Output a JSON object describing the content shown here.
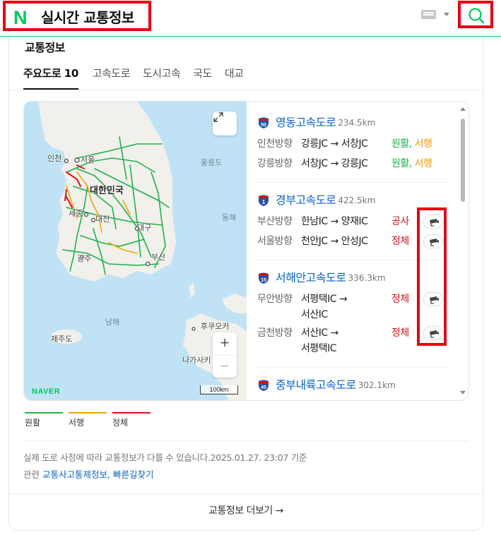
{
  "header": {
    "logo": "N",
    "title": "실시간 교통정보",
    "keyboard_icon": "keyboard-icon",
    "search_icon": "search-icon"
  },
  "section": {
    "title": "교통정보",
    "tabs": [
      {
        "label": "주요도로 10",
        "active": true
      },
      {
        "label": "고속도로",
        "active": false
      },
      {
        "label": "도시고속",
        "active": false
      },
      {
        "label": "국도",
        "active": false
      },
      {
        "label": "대교",
        "active": false
      }
    ]
  },
  "map": {
    "labels": {
      "incheon": "인천",
      "seoul": "서울",
      "country": "대한민국",
      "sejong": "세종",
      "daejeon": "대전",
      "daegu": "대구",
      "gwangju": "광주",
      "busan": "부산",
      "ulleung": "울릉도",
      "east_sea": "동해",
      "south_sea": "남해",
      "jeju": "제주도",
      "fukuoka": "후쿠오카",
      "nagasaki": "나가사키"
    },
    "brand": "NAVER",
    "scale": "100km",
    "zoom_in": "+",
    "zoom_out": "−"
  },
  "roads": [
    {
      "number": "50",
      "shield_color": "#2352a8",
      "name": "영동고속도로",
      "length": "234.5km",
      "directions": [
        {
          "dir": "인천방향",
          "route": "강릉JC → 서창JC",
          "status_parts": [
            {
              "text": "원활",
              "c": "g"
            },
            {
              "text": ", ",
              "c": "g"
            },
            {
              "text": "서행",
              "c": "o"
            }
          ],
          "cctv": false
        },
        {
          "dir": "강릉방향",
          "route": "서창JC → 강릉JC",
          "status_parts": [
            {
              "text": "원활",
              "c": "g"
            },
            {
              "text": ", ",
              "c": "g"
            },
            {
              "text": "서행",
              "c": "o"
            }
          ],
          "cctv": false
        }
      ]
    },
    {
      "number": "1",
      "shield_color": "#2352a8",
      "name": "경부고속도로",
      "length": "422.5km",
      "directions": [
        {
          "dir": "부산방향",
          "route": "한남IC → 양재IC",
          "status": "공사",
          "status_color": "r",
          "cctv": true
        },
        {
          "dir": "서울방향",
          "route": "천안JC → 안성JC",
          "status": "정체",
          "status_color": "r",
          "cctv": true
        }
      ]
    },
    {
      "number": "15",
      "shield_color": "#2352a8",
      "name": "서해안고속도로",
      "length": "336.3km",
      "directions": [
        {
          "dir": "무안방향",
          "route1": "서평택IC →",
          "route2": "서산IC",
          "status": "정체",
          "status_color": "r",
          "cctv": true
        },
        {
          "dir": "금천방향",
          "route1": "서산IC →",
          "route2": "서평택IC",
          "status": "정체",
          "status_color": "r",
          "cctv": true
        }
      ]
    },
    {
      "number": "45",
      "shield_color": "#2352a8",
      "name": "중부내륙고속도로",
      "length": "302.1km"
    }
  ],
  "legend": [
    {
      "label": "원활",
      "color": "#1cb24a"
    },
    {
      "label": "서행",
      "color": "#f3a500"
    },
    {
      "label": "정체",
      "color": "#d8121a"
    }
  ],
  "notice": "실제 도로 사정에 따라 교통정보가 다를 수 있습니다.2025.01.27. 23:07 기준",
  "related": {
    "prefix": "관련",
    "link1": "교통사고통제정보",
    "sep": ", ",
    "link2": "빠른길찾기"
  },
  "more": "교통정보 더보기 →"
}
